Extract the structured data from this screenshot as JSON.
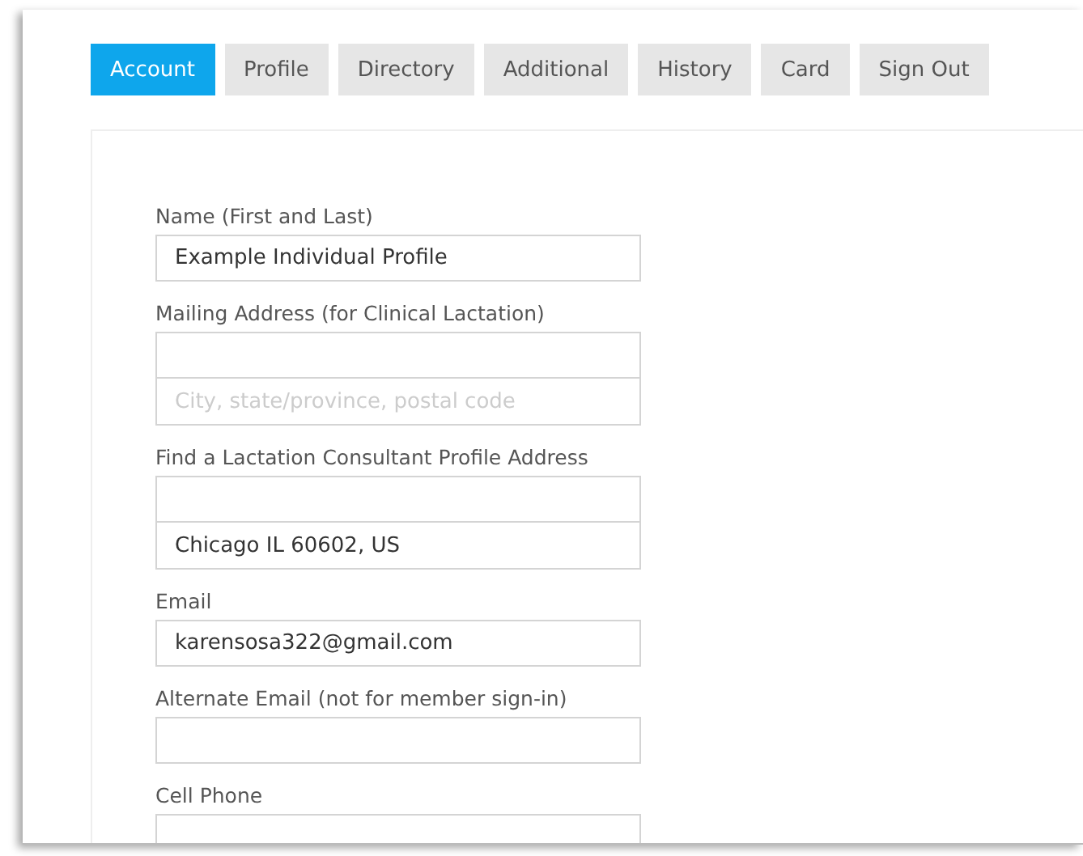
{
  "tabs": [
    {
      "label": "Account",
      "selected": true
    },
    {
      "label": "Profile",
      "selected": false
    },
    {
      "label": "Directory",
      "selected": false
    },
    {
      "label": "Additional",
      "selected": false
    },
    {
      "label": "History",
      "selected": false
    },
    {
      "label": "Card",
      "selected": false
    },
    {
      "label": "Sign Out",
      "selected": false
    }
  ],
  "fields": [
    {
      "label": "Name (First and Last)",
      "inputs": [
        {
          "kind": "filled",
          "value": "Example Individual Profile"
        }
      ]
    },
    {
      "label": "Mailing Address (for Clinical Lactation)",
      "inputs": [
        {
          "kind": "blank"
        },
        {
          "kind": "hint",
          "placeholder": "City, state/province, postal code"
        }
      ]
    },
    {
      "label": "Find a Lactation Consultant Profile Address",
      "inputs": [
        {
          "kind": "blank"
        },
        {
          "kind": "filled",
          "value": "Chicago IL 60602, US"
        }
      ]
    },
    {
      "label": "Email",
      "inputs": [
        {
          "kind": "filled",
          "value": "karensosa322@gmail.com"
        }
      ]
    },
    {
      "label": "Alternate Email (not for member sign-in)",
      "inputs": [
        {
          "kind": "blank"
        }
      ]
    },
    {
      "label": "Cell Phone",
      "inputs": [
        {
          "kind": "blank"
        }
      ]
    }
  ]
}
